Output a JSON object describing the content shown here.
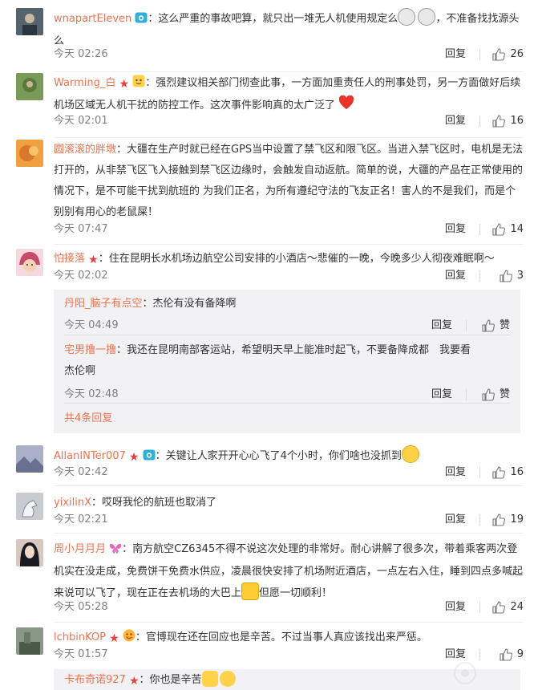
{
  "comments": [
    {
      "user": "wnapartEleven",
      "text1": "：这么严重的事故吧算，就只出一堆无人机使用规定么",
      "text2": "，不准备找找源头么",
      "time": "今天 02:26",
      "reply": "回复",
      "likes": "26",
      "avatar_color": "#6a7a86"
    },
    {
      "user": "Warming_白",
      "text1": "：强烈建议相关部门彻查此事，一方面加重责任人的刑事处罚，另一方面做好后续机场区域无人机干扰的防控工作。这次事件影响真的太广泛了",
      "time": "今天 02:01",
      "reply": "回复",
      "likes": "16",
      "avatar_color": "#7a9a5a"
    },
    {
      "user": "圆滚滚的胖墩",
      "text1": "：大疆在生产时就已经在GPS当中设置了禁飞区和限飞区。当进入禁飞区时，电机是无法打开的，从非禁飞区飞入接触到禁飞区边缘时，会触发自动返航。简单的说，大疆的产品在正常使用的情况下，是不可能干扰到航班的 为我们正名，为所有遵纪守法的飞友正名！害人的不是我们，而是个别别有用心的老鼠屎！",
      "time": "今天 07:47",
      "reply": "回复",
      "likes": "14",
      "avatar_color": "#d98b3a"
    },
    {
      "user": "怕接落",
      "text1": "：住在昆明长水机场边航空公司安排的小酒店～悲催的一晚，今晚多少人彻夜难眠啊～",
      "time": "今天 02:02",
      "reply": "回复",
      "likes": "3",
      "avatar_color": "#c64a6a"
    }
  ],
  "replies": [
    {
      "user": "丹阳_脑子有点空",
      "text": "：杰伦有没有备降啊",
      "time": "今天 04:49",
      "reply": "回复",
      "likes": "赞"
    },
    {
      "user": "宅男撸一撸",
      "text": "：我还在昆明南部客运站，希望明天早上能准时起飞，不要备降成都　我要看杰伦啊",
      "time": "今天 02:48",
      "reply": "回复",
      "likes": "赞"
    }
  ],
  "more_replies": "共4条回复",
  "comments2": [
    {
      "user": "AllanINTer007",
      "text1": "：关键让人家开开心心飞了4个小时，你们啥也没抓到",
      "time": "今天 02:42",
      "reply": "回复",
      "likes": "16",
      "avatar_color": "#8a8fa8"
    },
    {
      "user": "yixilinX",
      "text1": "：哎呀我伦的航班也取消了",
      "time": "今天 02:21",
      "reply": "回复",
      "likes": "19",
      "avatar_color": "#9aa0a6"
    },
    {
      "user": "周小月月月",
      "text1": "：南方航空CZ6345不得不说这次处理的非常好。耐心讲解了很多次，带着乘客两次登机实在没走成，免费饼干免费水供应，凌晨很快安排了机场附近酒店，一点左右入住，睡到四点多喊起来说可以飞了，现在正在去机场的大巴上",
      "text2": "但愿一切顺利！",
      "time": "今天 05:28",
      "reply": "回复",
      "likes": "24",
      "avatar_color": "#3a3a4a"
    },
    {
      "user": "lchbinKOP",
      "text1": "：官博现在还在回应也是辛苦。不过当事人真应该找出来严惩。",
      "time": "今天 01:57",
      "reply": "回复",
      "likes": "9",
      "avatar_color": "#5a6a5a"
    }
  ],
  "last_reply": {
    "user": "卡布奇诺927",
    "text": "：你也是辛苦"
  }
}
